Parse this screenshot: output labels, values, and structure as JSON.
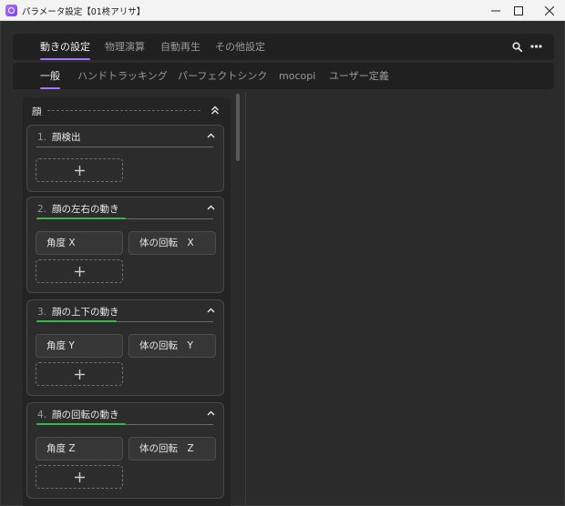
{
  "window": {
    "title": "パラメータ設定【01柊アリサ】",
    "minimize_icon": "minimize-icon",
    "maximize_icon": "maximize-icon",
    "close_icon": "close-icon"
  },
  "main_tabs": [
    {
      "label": "動きの設定",
      "active": true
    },
    {
      "label": "物理演算",
      "active": false
    },
    {
      "label": "自動再生",
      "active": false
    },
    {
      "label": "その他設定",
      "active": false
    }
  ],
  "toolbar": {
    "search_icon": "search-icon",
    "more_icon": "more-icon"
  },
  "sub_tabs": [
    {
      "label": "一般",
      "active": true
    },
    {
      "label": "ハンドトラッキング",
      "active": false
    },
    {
      "label": "パーフェクトシンク",
      "active": false
    },
    {
      "label": "mocopi",
      "active": false
    },
    {
      "label": "ユーザー定義",
      "active": false
    }
  ],
  "panel": {
    "title": "顔"
  },
  "cards": [
    {
      "number": "1.",
      "title": "顔検出",
      "chips": []
    },
    {
      "number": "2.",
      "title": "顔の左右の動き",
      "chips": [
        "角度 X",
        "体の回転　X"
      ]
    },
    {
      "number": "3.",
      "title": "顔の上下の動き",
      "chips": [
        "角度 Y",
        "体の回転　Y"
      ]
    },
    {
      "number": "4.",
      "title": "顔の回転の動き",
      "chips": [
        "角度 Z",
        "体の回転　Z"
      ]
    }
  ],
  "colors": {
    "accent": "#a675ff",
    "active_indicator": "#33b84a",
    "background": "#2b2b2b"
  }
}
